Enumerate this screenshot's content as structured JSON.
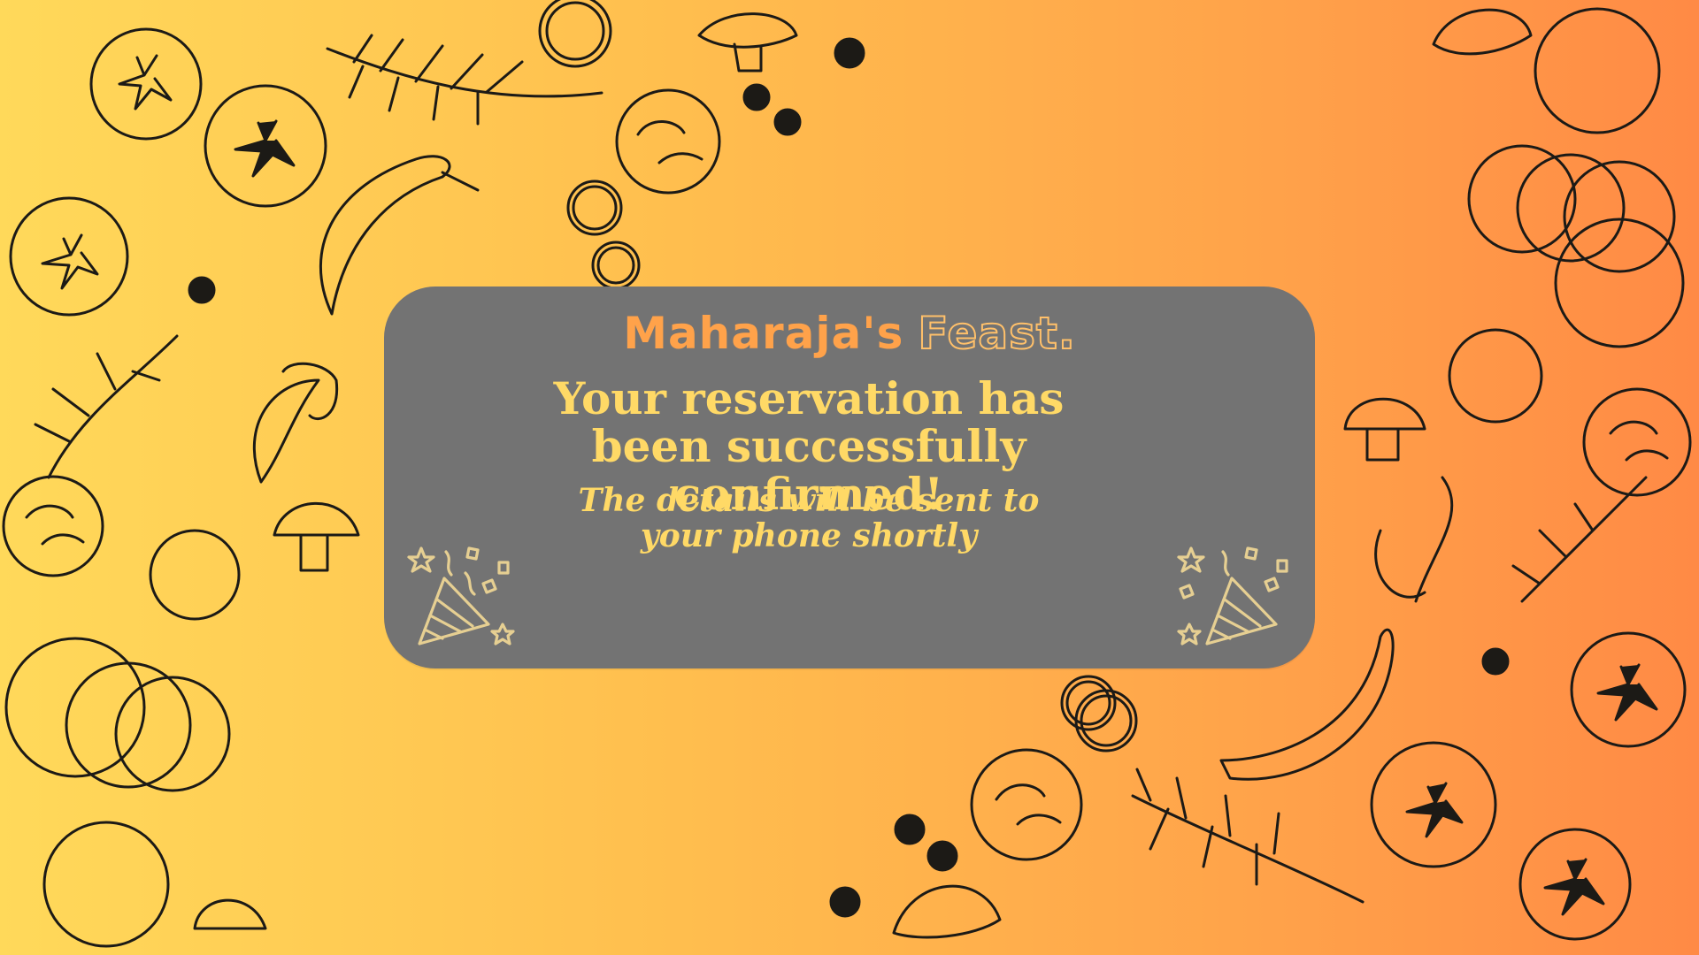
{
  "brand": {
    "name_primary": "Maharaja's",
    "name_secondary": "Feast."
  },
  "message": {
    "headline": "Your reservation has been successfully confirmed!",
    "details": "The details will be sent to your phone shortly"
  },
  "icons": {
    "left": "party-popper-icon",
    "right": "party-popper-icon"
  },
  "colors": {
    "background_start": "#ffd95a",
    "background_end": "#ff8a45",
    "card": "#737373",
    "brand_orange": "#ffa24a",
    "text_yellow": "#ffd966",
    "doodle_ink": "#1c1a16"
  }
}
